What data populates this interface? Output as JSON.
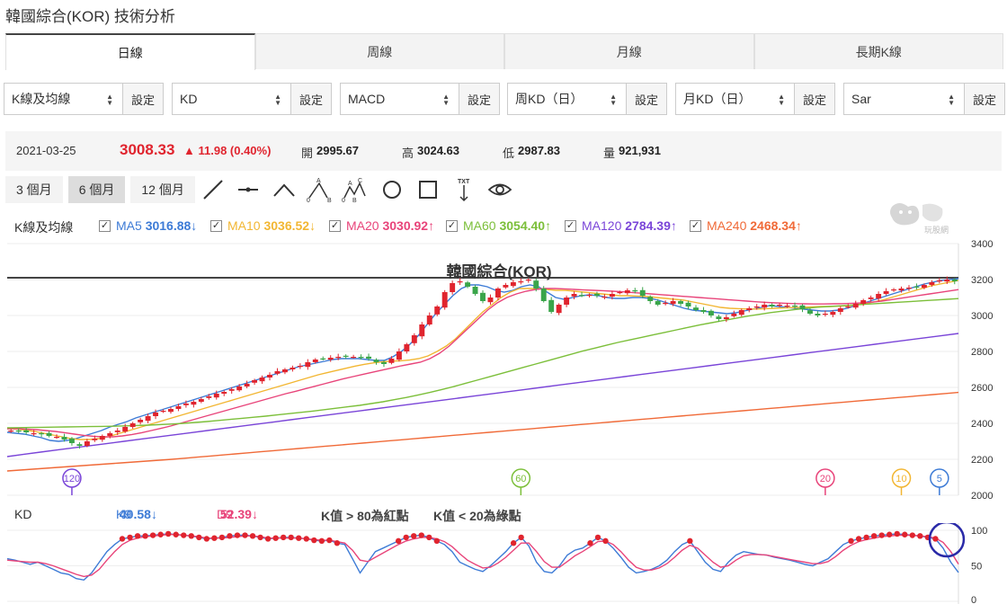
{
  "title": "韓國綜合(KOR) 技術分析",
  "tabs": [
    {
      "label": "日線",
      "active": true
    },
    {
      "label": "周線",
      "active": false
    },
    {
      "label": "月線",
      "active": false
    },
    {
      "label": "長期K線",
      "active": false
    }
  ],
  "selectors": [
    {
      "label": "K線及均線",
      "button": "設定"
    },
    {
      "label": "KD",
      "button": "設定"
    },
    {
      "label": "MACD",
      "button": "設定"
    },
    {
      "label": "周KD（日）",
      "button": "設定"
    },
    {
      "label": "月KD（日）",
      "button": "設定"
    },
    {
      "label": "Sar",
      "button": "設定"
    }
  ],
  "quote": {
    "date": "2021-03-25",
    "price": "3008.33",
    "change": "▲ 11.98 (0.40%)",
    "open_label": "開",
    "open": "2995.67",
    "high_label": "高",
    "high": "3024.63",
    "low_label": "低",
    "low": "2987.83",
    "volume_label": "量",
    "volume": "921,931"
  },
  "ranges": [
    {
      "label": "3 個月",
      "active": false
    },
    {
      "label": "6 個月",
      "active": true
    },
    {
      "label": "12 個月",
      "active": false
    }
  ],
  "tools": [
    "line-tool-icon",
    "horizontal-line-tool-icon",
    "angle-tool-icon",
    "abc-pattern-icon",
    "wave-pattern-icon",
    "circle-tool-icon",
    "rectangle-tool-icon",
    "text-tool-icon",
    "eye-icon"
  ],
  "tool_text": "TXT",
  "pattern_letters": {
    "a": "A",
    "b": "B",
    "c": "C",
    "zero": "0"
  },
  "logo_text": "玩股網",
  "ma_legend": {
    "label": "K線及均線",
    "items": [
      {
        "name": "MA5",
        "value": "3016.88",
        "arrow": "↓",
        "color": "#3d7bd6"
      },
      {
        "name": "MA10",
        "value": "3036.52",
        "arrow": "↓",
        "color": "#f2b632"
      },
      {
        "name": "MA20",
        "value": "3030.92",
        "arrow": "↑",
        "color": "#e8447a"
      },
      {
        "name": "MA60",
        "value": "3054.40",
        "arrow": "↑",
        "color": "#7cbf3a"
      },
      {
        "name": "MA120",
        "value": "2784.39",
        "arrow": "↑",
        "color": "#7a45d8"
      },
      {
        "name": "MA240",
        "value": "2468.34",
        "arrow": "↑",
        "color": "#f06a38"
      }
    ]
  },
  "chart_label": "韓國綜合(KOR)",
  "markers": [
    {
      "label": "120",
      "color": "#7a45d8",
      "index": 8
    },
    {
      "label": "60",
      "color": "#7cbf3a",
      "index": 67
    },
    {
      "label": "20",
      "color": "#e8447a",
      "index": 107
    },
    {
      "label": "10",
      "color": "#f2b632",
      "index": 117
    },
    {
      "label": "5",
      "color": "#3d7bd6",
      "index": 122
    }
  ],
  "kd_legend": {
    "label": "KD",
    "k_label": "K9",
    "k_value": "40.58",
    "k_arrow": "↓",
    "d_label": "D9",
    "d_value": "52.39",
    "d_arrow": "↓",
    "note1": "K值 > 80為紅點",
    "note2": "K值 < 20為綠點"
  },
  "colors": {
    "up": "#e0242e",
    "down": "#3aa54a",
    "k_line": "#3d7bd6",
    "d_line": "#e8447a",
    "highlight": "#2a2aa8"
  },
  "chart_data": [
    {
      "type": "candlestick",
      "title": "韓國綜合(KOR)",
      "ylim": [
        2000,
        3400
      ],
      "yticks": [
        2000,
        2200,
        2400,
        2600,
        2800,
        3000,
        3200,
        3400
      ],
      "reference_line": 3210,
      "close": [
        2360,
        2355,
        2350,
        2345,
        2340,
        2330,
        2325,
        2310,
        2290,
        2275,
        2300,
        2315,
        2330,
        2345,
        2360,
        2380,
        2400,
        2420,
        2440,
        2460,
        2470,
        2480,
        2495,
        2510,
        2520,
        2535,
        2550,
        2565,
        2575,
        2590,
        2605,
        2620,
        2640,
        2655,
        2670,
        2690,
        2700,
        2710,
        2720,
        2740,
        2755,
        2760,
        2765,
        2770,
        2775,
        2770,
        2765,
        2760,
        2740,
        2730,
        2760,
        2800,
        2840,
        2890,
        2950,
        3000,
        3050,
        3130,
        3180,
        3190,
        3160,
        3120,
        3080,
        3100,
        3150,
        3170,
        3185,
        3190,
        3200,
        3150,
        3080,
        3020,
        3060,
        3100,
        3120,
        3110,
        3115,
        3110,
        3105,
        3120,
        3130,
        3140,
        3135,
        3110,
        3080,
        3060,
        3070,
        3080,
        3065,
        3050,
        3030,
        3020,
        3000,
        2980,
        2990,
        3010,
        3030,
        3040,
        3050,
        3060,
        3050,
        3060,
        3055,
        3050,
        3035,
        3010,
        3000,
        3010,
        3020,
        3040,
        3050,
        3065,
        3085,
        3100,
        3120,
        3135,
        3145,
        3150,
        3155,
        3160,
        3170,
        3185,
        3195,
        3200,
        3190
      ],
      "series": [
        {
          "name": "MA5",
          "values": [
            2350,
            2345,
            2340,
            2330,
            2320,
            2305,
            2300,
            2305,
            2315,
            2330,
            2345,
            2360,
            2380,
            2395,
            2410,
            2430,
            2445,
            2460,
            2475,
            2490,
            2505,
            2520,
            2535,
            2550,
            2565,
            2580,
            2595,
            2610,
            2625,
            2640,
            2655,
            2670,
            2685,
            2700,
            2715,
            2725,
            2735,
            2745,
            2755,
            2760,
            2760,
            2760,
            2755,
            2750,
            2750,
            2770,
            2800,
            2840,
            2890,
            2950,
            3010,
            3060,
            3110,
            3150,
            3170,
            3170,
            3160,
            3140,
            3130,
            3140,
            3160,
            3170,
            3160,
            3130,
            3100,
            3090,
            3100,
            3110,
            3115,
            3110,
            3100,
            3095,
            3095,
            3100,
            3100,
            3095,
            3085,
            3070,
            3055,
            3040,
            3030,
            3025,
            3020,
            3015,
            3010,
            3015,
            3025,
            3035,
            3045,
            3055,
            3050,
            3045,
            3040,
            3035,
            3030,
            3025,
            3025,
            3030,
            3040,
            3055,
            3070,
            3085,
            3100,
            3115,
            3130,
            3145,
            3160,
            3175,
            3185,
            3195,
            3200,
            3205
          ]
        },
        {
          "name": "MA10",
          "values": [
            2370,
            2368,
            2362,
            2355,
            2345,
            2335,
            2325,
            2315,
            2310,
            2310,
            2315,
            2325,
            2340,
            2355,
            2370,
            2385,
            2400,
            2415,
            2430,
            2445,
            2460,
            2475,
            2490,
            2505,
            2520,
            2535,
            2550,
            2565,
            2580,
            2595,
            2610,
            2625,
            2640,
            2655,
            2670,
            2682,
            2694,
            2706,
            2718,
            2728,
            2736,
            2742,
            2746,
            2748,
            2752,
            2760,
            2775,
            2800,
            2830,
            2870,
            2920,
            2970,
            3020,
            3060,
            3100,
            3130,
            3150,
            3150,
            3150,
            3145,
            3140,
            3140,
            3135,
            3130,
            3125,
            3120,
            3115,
            3110,
            3110,
            3108,
            3105,
            3100,
            3095,
            3090,
            3085,
            3075,
            3065,
            3055,
            3045,
            3040,
            3038,
            3036,
            3036,
            3038,
            3040,
            3042,
            3044,
            3046,
            3048,
            3050,
            3050,
            3052,
            3055,
            3060,
            3068,
            3078,
            3090,
            3105,
            3120,
            3135,
            3150,
            3165,
            3175,
            3185,
            3195
          ]
        },
        {
          "name": "MA20",
          "values": [
            2370,
            2370,
            2368,
            2365,
            2360,
            2355,
            2348,
            2340,
            2333,
            2328,
            2325,
            2325,
            2330,
            2338,
            2348,
            2360,
            2372,
            2385,
            2400,
            2415,
            2430,
            2445,
            2460,
            2475,
            2490,
            2505,
            2520,
            2535,
            2550,
            2565,
            2578,
            2592,
            2606,
            2620,
            2634,
            2648,
            2660,
            2672,
            2684,
            2696,
            2708,
            2720,
            2730,
            2740,
            2760,
            2790,
            2830,
            2880,
            2930,
            2980,
            3030,
            3070,
            3100,
            3120,
            3135,
            3145,
            3150,
            3150,
            3148,
            3145,
            3142,
            3140,
            3138,
            3135,
            3132,
            3128,
            3124,
            3120,
            3116,
            3112,
            3108,
            3104,
            3100,
            3096,
            3092,
            3088,
            3084,
            3080,
            3076,
            3073,
            3070,
            3068,
            3066,
            3065,
            3064,
            3064,
            3065,
            3066,
            3068,
            3070,
            3074,
            3080,
            3088,
            3096,
            3104,
            3112,
            3120,
            3128,
            3136,
            3144
          ]
        },
        {
          "name": "MA60",
          "values": [
            2375,
            2376,
            2377,
            2378,
            2379,
            2380,
            2381,
            2382,
            2383,
            2384,
            2386,
            2388,
            2390,
            2393,
            2396,
            2400,
            2405,
            2410,
            2416,
            2422,
            2428,
            2434,
            2440,
            2447,
            2454,
            2461,
            2468,
            2476,
            2484,
            2492,
            2500,
            2510,
            2520,
            2532,
            2544,
            2558,
            2572,
            2588,
            2604,
            2622,
            2640,
            2658,
            2676,
            2694,
            2712,
            2730,
            2748,
            2766,
            2784,
            2802,
            2818,
            2834,
            2850,
            2864,
            2878,
            2892,
            2906,
            2920,
            2934,
            2948,
            2960,
            2972,
            2984,
            2996,
            3006,
            3016,
            3024,
            3032,
            3040,
            3046,
            3050,
            3054,
            3058,
            3062,
            3066,
            3070,
            3074,
            3078,
            3082,
            3086,
            3090,
            3094
          ]
        },
        {
          "name": "MA120",
          "values": [
            2215,
            2228,
            2240,
            2252,
            2264,
            2276,
            2288,
            2300,
            2312,
            2324,
            2336,
            2348,
            2360,
            2372,
            2384,
            2396,
            2408,
            2420,
            2432,
            2444,
            2456,
            2468,
            2480,
            2492,
            2504,
            2516,
            2528,
            2540,
            2552,
            2564,
            2576,
            2588,
            2600,
            2612,
            2624,
            2636,
            2648,
            2660,
            2672,
            2684,
            2696,
            2708,
            2720,
            2732,
            2744,
            2756,
            2768,
            2780,
            2792,
            2804,
            2816,
            2828,
            2840,
            2852,
            2864,
            2876,
            2888,
            2900
          ]
        },
        {
          "name": "MA240",
          "values": [
            2135,
            2140,
            2145,
            2150,
            2155,
            2160,
            2165,
            2170,
            2175,
            2180,
            2185,
            2190,
            2195,
            2200,
            2206,
            2212,
            2218,
            2224,
            2230,
            2236,
            2242,
            2248,
            2254,
            2260,
            2266,
            2272,
            2278,
            2284,
            2290,
            2296,
            2302,
            2308,
            2314,
            2320,
            2326,
            2332,
            2338,
            2344,
            2350,
            2356,
            2362,
            2368,
            2374,
            2380,
            2386,
            2392,
            2398,
            2404,
            2410,
            2416,
            2422,
            2428,
            2434,
            2440,
            2446,
            2452,
            2458,
            2464,
            2470,
            2476,
            2482,
            2488,
            2494,
            2500,
            2506,
            2512,
            2518,
            2524,
            2530,
            2536,
            2542,
            2548,
            2554,
            2560,
            2566,
            2572
          ]
        }
      ]
    },
    {
      "type": "line",
      "title": "KD",
      "ylim": [
        0,
        100
      ],
      "yticks": [
        0,
        50,
        100
      ],
      "series": [
        {
          "name": "K9",
          "values": [
            60,
            58,
            55,
            52,
            55,
            50,
            45,
            40,
            38,
            32,
            30,
            40,
            55,
            70,
            80,
            88,
            90,
            92,
            92,
            93,
            94,
            95,
            94,
            93,
            92,
            90,
            88,
            89,
            90,
            92,
            93,
            93,
            92,
            90,
            88,
            89,
            90,
            90,
            89,
            88,
            86,
            85,
            86,
            82,
            80,
            60,
            40,
            55,
            70,
            75,
            80,
            85,
            90,
            92,
            93,
            90,
            85,
            80,
            70,
            55,
            50,
            45,
            42,
            50,
            60,
            70,
            82,
            90,
            78,
            55,
            42,
            40,
            50,
            65,
            72,
            75,
            82,
            90,
            85,
            75,
            62,
            48,
            40,
            42,
            45,
            50,
            58,
            70,
            80,
            85,
            70,
            55,
            45,
            42,
            55,
            65,
            70,
            68,
            66,
            65,
            62,
            60,
            58,
            55,
            52,
            50,
            55,
            60,
            70,
            80,
            85,
            88,
            90,
            92,
            93,
            94,
            95,
            94,
            93,
            92,
            90,
            88,
            75,
            55,
            40.58
          ]
        },
        {
          "name": "D9",
          "values": [
            58,
            57,
            56,
            55,
            55,
            53,
            50,
            46,
            42,
            38,
            35,
            37,
            45,
            58,
            70,
            80,
            86,
            89,
            91,
            92,
            93,
            94,
            94,
            93,
            92,
            91,
            89,
            89,
            89,
            90,
            91,
            92,
            92,
            91,
            89,
            89,
            89,
            89,
            89,
            88,
            87,
            86,
            86,
            84,
            82,
            72,
            58,
            56,
            62,
            68,
            74,
            80,
            85,
            88,
            90,
            90,
            88,
            84,
            77,
            67,
            58,
            52,
            47,
            48,
            54,
            62,
            72,
            82,
            82,
            70,
            56,
            48,
            48,
            56,
            64,
            70,
            77,
            84,
            85,
            80,
            70,
            58,
            48,
            44,
            44,
            47,
            53,
            62,
            72,
            79,
            75,
            65,
            55,
            48,
            50,
            58,
            64,
            66,
            66,
            65,
            63,
            61,
            59,
            57,
            55,
            53,
            53,
            56,
            63,
            72,
            79,
            84,
            87,
            89,
            91,
            92,
            93,
            93,
            93,
            92,
            91,
            89,
            83,
            70,
            52.39
          ]
        }
      ]
    }
  ]
}
